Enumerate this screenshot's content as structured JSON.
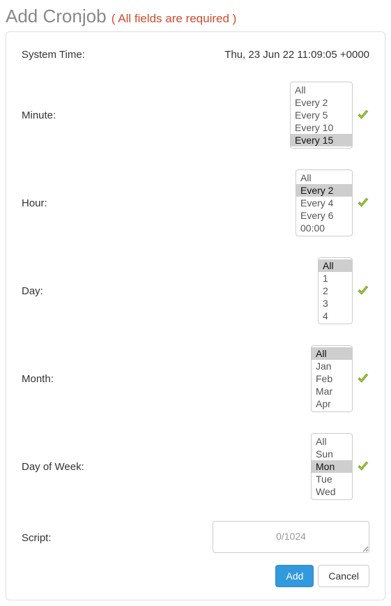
{
  "header": {
    "title": "Add Cronjob",
    "required_note": "( All fields are required )"
  },
  "form": {
    "system_time": {
      "label": "System Time:",
      "value": "Thu, 23 Jun 22 11:09:05 +0000"
    },
    "minute": {
      "label": "Minute:",
      "options": [
        "All",
        "Every 2",
        "Every 5",
        "Every 10",
        "Every 15"
      ],
      "selected": [
        "Every 15"
      ]
    },
    "hour": {
      "label": "Hour:",
      "options": [
        "All",
        "Every 2",
        "Every 4",
        "Every 6",
        "00:00"
      ],
      "selected": [
        "Every 2"
      ]
    },
    "day": {
      "label": "Day:",
      "options": [
        "All",
        "1",
        "2",
        "3",
        "4"
      ],
      "selected": [
        "All"
      ]
    },
    "month": {
      "label": "Month:",
      "options": [
        "All",
        "Jan",
        "Feb",
        "Mar",
        "Apr"
      ],
      "selected": [
        "All"
      ]
    },
    "day_of_week": {
      "label": "Day of Week:",
      "options": [
        "All",
        "Sun",
        "Mon",
        "Tue",
        "Wed"
      ],
      "selected": [
        "Mon"
      ]
    },
    "script": {
      "label": "Script:",
      "value": "",
      "counter": "0/1024"
    }
  },
  "actions": {
    "add": "Add",
    "cancel": "Cancel"
  }
}
